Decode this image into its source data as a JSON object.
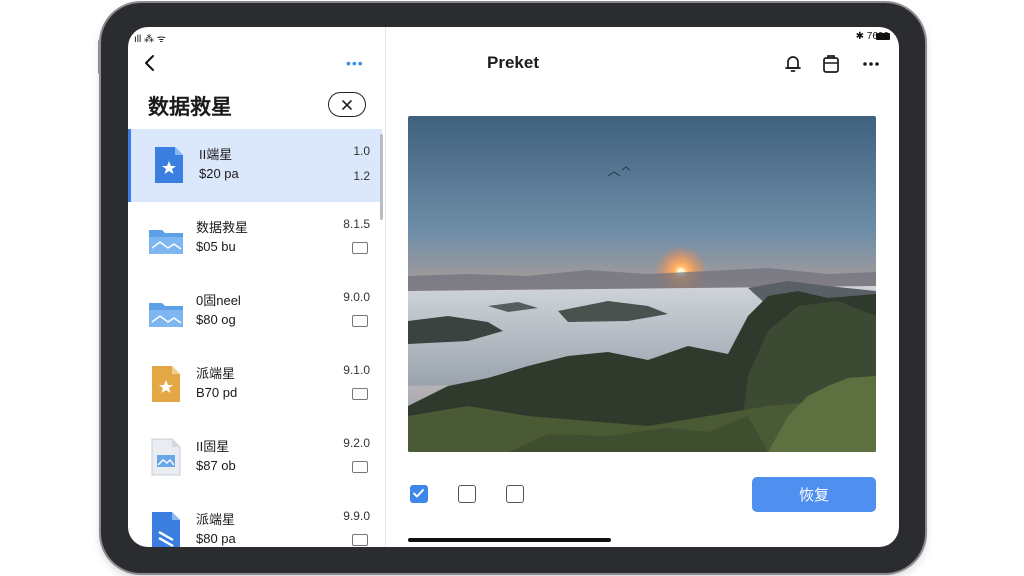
{
  "status": {
    "left": "ıll ⁂ ᯤ",
    "right": "✱ 7600"
  },
  "sidebar": {
    "more_label": "•••",
    "title": "数据救星",
    "items": [
      {
        "name": "II端星",
        "sub": "$20 pa",
        "version": "1.0",
        "version2": "1.2",
        "icon": "blue-document-icon"
      },
      {
        "name": "数据救星",
        "sub": "$05 bu",
        "version": "8.1.5",
        "icon": "blue-folder-icon"
      },
      {
        "name": "0固neel",
        "sub": "$80 og",
        "version": "9.0.0",
        "icon": "blue-folder-icon"
      },
      {
        "name": "派端星",
        "sub": "B70 pd",
        "version": "9.1.0",
        "icon": "orange-document-icon"
      },
      {
        "name": "II固星",
        "sub": "$87 ob",
        "version": "9.2.0",
        "icon": "image-file-icon"
      },
      {
        "name": "派端星",
        "sub": "$80 pa",
        "version": "9.9.0",
        "icon": "blue-document-icon"
      }
    ]
  },
  "main": {
    "title": "Preket",
    "restore_label": "恢复",
    "checkboxes": [
      {
        "checked": true
      },
      {
        "checked": false
      },
      {
        "checked": false
      }
    ]
  },
  "colors": {
    "accent": "#3d86ea",
    "selected_row": "#dbe7fb",
    "button": "#4f8ff0"
  }
}
